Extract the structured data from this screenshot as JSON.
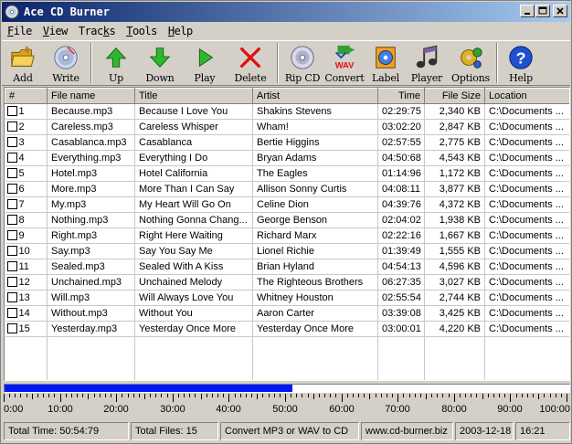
{
  "window": {
    "title": "Ace CD Burner"
  },
  "menu": [
    {
      "label": "File",
      "ul": "F",
      "rest": "ile"
    },
    {
      "label": "View",
      "ul": "V",
      "rest": "iew"
    },
    {
      "label": "Tracks",
      "pre": "Trac",
      "ul": "k",
      "rest": "s"
    },
    {
      "label": "Tools",
      "ul": "T",
      "rest": "ools"
    },
    {
      "label": "Help",
      "ul": "H",
      "rest": "elp"
    }
  ],
  "toolbar": {
    "add": "Add",
    "write": "Write",
    "up": "Up",
    "down": "Down",
    "play": "Play",
    "delete": "Delete",
    "rip_cd": "Rip CD",
    "convert": "Convert",
    "label": "Label",
    "player": "Player",
    "options": "Options",
    "help": "Help"
  },
  "columns": [
    "#",
    "File name",
    "Title",
    "Artist",
    "Time",
    "File Size",
    "Location"
  ],
  "tracks": [
    {
      "n": "1",
      "file": "Because.mp3",
      "title": "Because I Love You",
      "artist": "Shakins Stevens",
      "time": "02:29:75",
      "size": "2,340 KB",
      "loc": "C:\\Documents ..."
    },
    {
      "n": "2",
      "file": "Careless.mp3",
      "title": "Careless Whisper",
      "artist": "Wham!",
      "time": "03:02:20",
      "size": "2,847 KB",
      "loc": "C:\\Documents ..."
    },
    {
      "n": "3",
      "file": "Casablanca.mp3",
      "title": "Casablanca",
      "artist": "Bertie Higgins",
      "time": "02:57:55",
      "size": "2,775 KB",
      "loc": "C:\\Documents ..."
    },
    {
      "n": "4",
      "file": "Everything.mp3",
      "title": "Everything I Do",
      "artist": "Bryan Adams",
      "time": "04:50:68",
      "size": "4,543 KB",
      "loc": "C:\\Documents ..."
    },
    {
      "n": "5",
      "file": "Hotel.mp3",
      "title": "Hotel California",
      "artist": "The Eagles",
      "time": "01:14:96",
      "size": "1,172 KB",
      "loc": "C:\\Documents ..."
    },
    {
      "n": "6",
      "file": "More.mp3",
      "title": "More Than I Can Say",
      "artist": "Allison Sonny Curtis",
      "time": "04:08:11",
      "size": "3,877 KB",
      "loc": "C:\\Documents ..."
    },
    {
      "n": "7",
      "file": "My.mp3",
      "title": "My Heart Will Go On",
      "artist": "Celine Dion",
      "time": "04:39:76",
      "size": "4,372 KB",
      "loc": "C:\\Documents ..."
    },
    {
      "n": "8",
      "file": "Nothing.mp3",
      "title": "Nothing Gonna Chang...",
      "artist": "George Benson",
      "time": "02:04:02",
      "size": "1,938 KB",
      "loc": "C:\\Documents ..."
    },
    {
      "n": "9",
      "file": "Right.mp3",
      "title": "Right Here Waiting",
      "artist": "Richard Marx",
      "time": "02:22:16",
      "size": "1,667 KB",
      "loc": "C:\\Documents ..."
    },
    {
      "n": "10",
      "file": "Say.mp3",
      "title": "Say You Say Me",
      "artist": "Lionel Richie",
      "time": "01:39:49",
      "size": "1,555 KB",
      "loc": "C:\\Documents ..."
    },
    {
      "n": "11",
      "file": "Sealed.mp3",
      "title": "Sealed With A Kiss",
      "artist": "Brian Hyland",
      "time": "04:54:13",
      "size": "4,596 KB",
      "loc": "C:\\Documents ..."
    },
    {
      "n": "12",
      "file": "Unchained.mp3",
      "title": "Unchained Melody",
      "artist": "The Righteous Brothers",
      "time": "06:27:35",
      "size": "3,027 KB",
      "loc": "C:\\Documents ..."
    },
    {
      "n": "13",
      "file": "Will.mp3",
      "title": "Will Always Love You",
      "artist": "Whitney Houston",
      "time": "02:55:54",
      "size": "2,744 KB",
      "loc": "C:\\Documents ..."
    },
    {
      "n": "14",
      "file": "Without.mp3",
      "title": "Without You",
      "artist": "Aaron Carter",
      "time": "03:39:08",
      "size": "3,425 KB",
      "loc": "C:\\Documents ..."
    },
    {
      "n": "15",
      "file": "Yesterday.mp3",
      "title": "Yesterday Once More",
      "artist": "Yesterday Once More",
      "time": "03:00:01",
      "size": "4,220 KB",
      "loc": "C:\\Documents ..."
    }
  ],
  "progress": {
    "fraction": 0.51
  },
  "ruler": {
    "labels": [
      "0:00",
      "10:00",
      "20:00",
      "30:00",
      "40:00",
      "50:00",
      "60:00",
      "70:00",
      "80:00",
      "90:00",
      "100:00"
    ]
  },
  "status": {
    "total_time": "Total Time: 50:54:79",
    "total_files": "Total Files: 15",
    "message": "Convert MP3 or WAV to CD",
    "website": "www.cd-burner.biz",
    "date": "2003-12-18",
    "time": "16:21"
  },
  "colors": {
    "titlebar_start": "#0a246a",
    "titlebar_end": "#a6caf0",
    "progress_fill": "#0018f8",
    "face": "#d4d0c8"
  }
}
